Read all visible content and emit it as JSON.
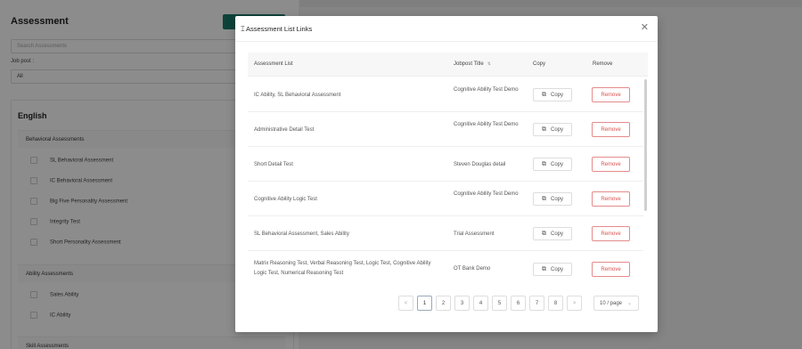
{
  "background": {
    "title": "Assessment",
    "search_placeholder": "Search Assessments",
    "jobpost_label": "Job post :",
    "jobpost_value": "All",
    "language": "English",
    "groups": [
      {
        "label": "Behavioral Assessments",
        "items": [
          "SL Behavioral Assessment",
          "IC Behavioral Assessment",
          "Big Five Personality Assessment",
          "Integrity Test",
          "Short Personality Assessment"
        ]
      },
      {
        "label": "Ability Assessments",
        "items": [
          "Sales Ability",
          "IC Ability"
        ]
      },
      {
        "label": "Skill Assessments",
        "items": []
      }
    ]
  },
  "modal": {
    "title": "Assessment List Links",
    "close_icon": "close-icon",
    "columns": {
      "assessment_list": "Assessment List",
      "jobpost_title": "Jobpost Title",
      "copy": "Copy",
      "remove": "Remove"
    },
    "copy_label": "Copy",
    "remove_label": "Remove",
    "rows": [
      {
        "assessments": "IC Ability, SL Behavioral Assessment",
        "jobpost": "Cognitive Ability Test Demo"
      },
      {
        "assessments": "Administrative Detail Test",
        "jobpost": "Cognitive Ability Test Demo"
      },
      {
        "assessments": "Short Detail Test",
        "jobpost": "Steven Douglas detail"
      },
      {
        "assessments": "Cognitive Ability Logic Test",
        "jobpost": "Cognitive Ability Test Demo"
      },
      {
        "assessments": "SL Behavioral Assessment, Sales Ability",
        "jobpost": "Trial Assessment"
      },
      {
        "assessments": "Matrix Reasoning Test, Verbal Reasoning Test, Logic Test, Cognitive Ability Logic Test, Numerical Reasoning Test",
        "jobpost": "OT Bank Demo"
      }
    ],
    "pagination": {
      "prev": "<",
      "next": ">",
      "pages": [
        "1",
        "2",
        "3",
        "4",
        "5",
        "6",
        "7",
        "8"
      ],
      "current_page": "1",
      "page_size": "10 / page"
    }
  }
}
